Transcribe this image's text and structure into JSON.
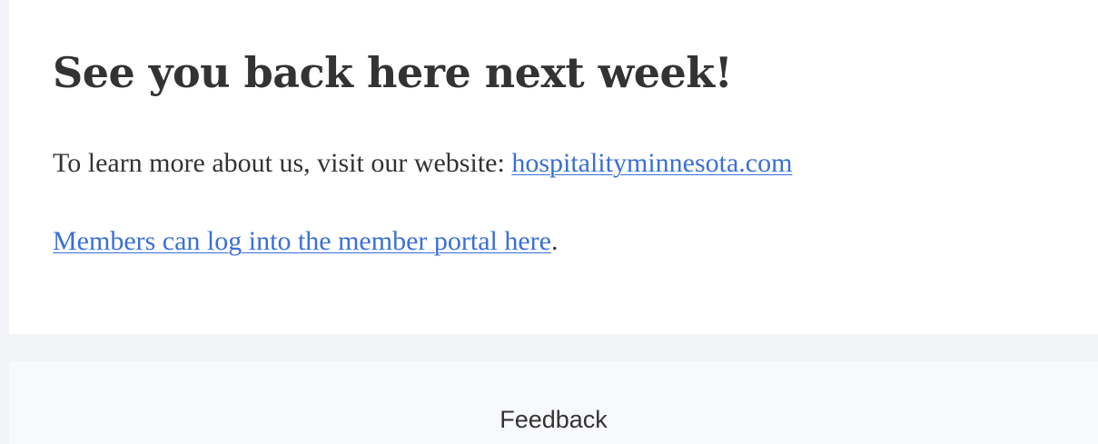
{
  "main": {
    "headline": "See you back here next week!",
    "learn_more_prefix": "To learn more about us, visit our website: ",
    "website_link": "hospitalityminnesota.com",
    "member_portal_link": "Members can log into the member portal here",
    "member_portal_suffix": "."
  },
  "footer": {
    "feedback_label": "Feedback"
  },
  "colors": {
    "page_background": "#f2f4f8",
    "card_background": "#ffffff",
    "footer_background": "#f8f9fc",
    "text": "#333333",
    "link": "#3a6fd8"
  }
}
